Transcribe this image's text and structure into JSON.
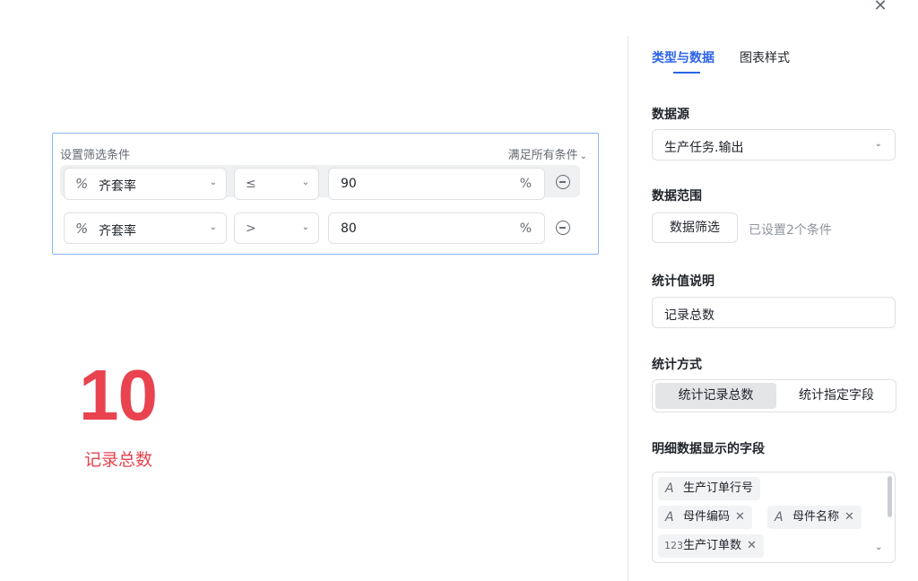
{
  "window": {
    "close_icon": "close-icon",
    "close_glyph": "✕"
  },
  "filter": {
    "title": "设置筛选条件",
    "match_mode": "满足所有条件",
    "conditions": [
      {
        "field_icon": "percent-field-icon",
        "field_glyph": "%",
        "field": "齐套率",
        "operator": "≤",
        "value": "90",
        "unit": "%"
      },
      {
        "field_icon": "percent-field-icon",
        "field_glyph": "%",
        "field": "齐套率",
        "operator": ">",
        "value": "80",
        "unit": "%"
      }
    ]
  },
  "stat": {
    "value": "10",
    "label": "记录总数",
    "color": "#e8434f"
  },
  "panel": {
    "tabs": [
      {
        "label": "类型与数据",
        "active": true
      },
      {
        "label": "图表样式",
        "active": false
      }
    ],
    "accent": "#2d64e8",
    "data_source": {
      "label": "数据源",
      "value": "生产任务.输出"
    },
    "data_range": {
      "label": "数据范围",
      "button": "数据筛选",
      "note": "已设置2个条件"
    },
    "stat_desc": {
      "label": "统计值说明",
      "value": "记录总数"
    },
    "stat_method": {
      "label": "统计方式",
      "options": [
        "统计记录总数",
        "统计指定字段"
      ],
      "selected": "统计记录总数"
    },
    "detail_fields": {
      "label": "明细数据显示的字段",
      "chips": [
        {
          "icon": "text-field-icon",
          "glyph": "A",
          "label": "生产订单行号",
          "removable": false
        },
        {
          "icon": "text-field-icon",
          "glyph": "A",
          "label": "母件编码",
          "removable": true
        },
        {
          "icon": "text-field-icon",
          "glyph": "A",
          "label": "母件名称",
          "removable": true
        },
        {
          "icon": "number-field-icon",
          "glyph": "123",
          "label": "生产订单数",
          "removable": true
        }
      ]
    }
  }
}
